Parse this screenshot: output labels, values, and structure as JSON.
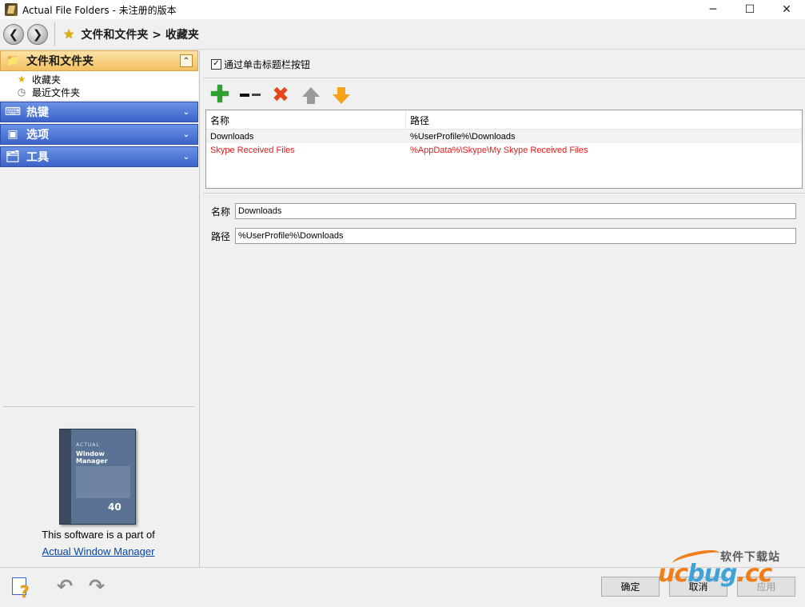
{
  "window": {
    "title": "Actual File Folders - 未注册的版本",
    "minimize": "─",
    "maximize": "☐",
    "close": "✕"
  },
  "nav": {
    "back": "❮",
    "forward": "❯",
    "breadcrumb": "文件和文件夹 > 收藏夹"
  },
  "sidebar": {
    "sections": [
      {
        "label": "文件和文件夹",
        "icon": "folder-icon",
        "expanded": true,
        "items": [
          {
            "label": "收藏夹",
            "icon": "star-icon"
          },
          {
            "label": "最近文件夹",
            "icon": "clock-icon"
          }
        ]
      },
      {
        "label": "热键",
        "icon": "keyboard-icon",
        "expanded": false
      },
      {
        "label": "选项",
        "icon": "options-icon",
        "expanded": false
      },
      {
        "label": "工具",
        "icon": "tools-icon",
        "expanded": false
      }
    ],
    "ad": {
      "text": "This software is a part of",
      "link": "Actual Window Manager",
      "box_small": "ACTUAL",
      "box_title": "Window Manager",
      "box_number": "40"
    }
  },
  "main": {
    "checkbox_label": "通过单击标题栏按钮",
    "checkbox_checked": true,
    "toolbar": {
      "add": "add-icon",
      "remove": "remove-icon",
      "delete": "delete-icon",
      "move_up": "move-up-icon",
      "move_down": "move-down-icon"
    },
    "table": {
      "columns": [
        "名称",
        "路径"
      ],
      "rows": [
        {
          "name": "Downloads",
          "path": "%UserProfile%\\Downloads",
          "selected": true,
          "color": "#000000"
        },
        {
          "name": "Skype Received Files",
          "path": "%AppData%\\Skype\\My Skype Received Files",
          "selected": false,
          "color": "#e81818"
        }
      ]
    },
    "fields": {
      "name_label": "名称",
      "name_value": "Downloads",
      "path_label": "路径",
      "path_value": "%UserProfile%\\Downloads"
    }
  },
  "footer": {
    "ok": "确定",
    "cancel": "取消",
    "apply": "应用"
  },
  "watermark": {
    "cn": "软件下载站",
    "logo_u": "uc",
    "logo_b": "bug",
    "logo_cc": ".cc"
  },
  "colors": {
    "accent_active": "#f3c062",
    "accent_blue": "#3b63c9",
    "highlight_red": "#e81818",
    "link": "#0645ad"
  }
}
